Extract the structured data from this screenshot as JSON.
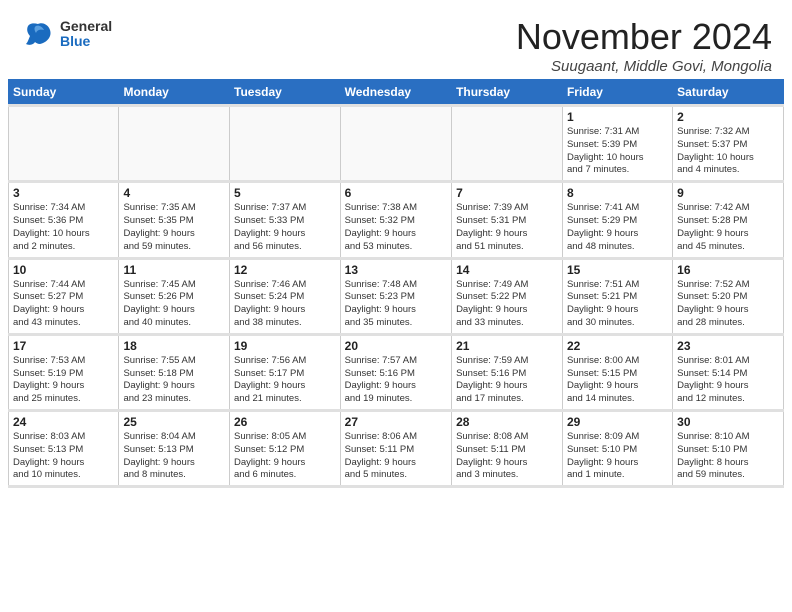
{
  "header": {
    "logo_text_general": "General",
    "logo_text_blue": "Blue",
    "month_title": "November 2024",
    "location": "Suugaant, Middle Govi, Mongolia"
  },
  "calendar": {
    "columns": [
      "Sunday",
      "Monday",
      "Tuesday",
      "Wednesday",
      "Thursday",
      "Friday",
      "Saturday"
    ],
    "weeks": [
      [
        {
          "day": "",
          "info": ""
        },
        {
          "day": "",
          "info": ""
        },
        {
          "day": "",
          "info": ""
        },
        {
          "day": "",
          "info": ""
        },
        {
          "day": "",
          "info": ""
        },
        {
          "day": "1",
          "info": "Sunrise: 7:31 AM\nSunset: 5:39 PM\nDaylight: 10 hours\nand 7 minutes."
        },
        {
          "day": "2",
          "info": "Sunrise: 7:32 AM\nSunset: 5:37 PM\nDaylight: 10 hours\nand 4 minutes."
        }
      ],
      [
        {
          "day": "3",
          "info": "Sunrise: 7:34 AM\nSunset: 5:36 PM\nDaylight: 10 hours\nand 2 minutes."
        },
        {
          "day": "4",
          "info": "Sunrise: 7:35 AM\nSunset: 5:35 PM\nDaylight: 9 hours\nand 59 minutes."
        },
        {
          "day": "5",
          "info": "Sunrise: 7:37 AM\nSunset: 5:33 PM\nDaylight: 9 hours\nand 56 minutes."
        },
        {
          "day": "6",
          "info": "Sunrise: 7:38 AM\nSunset: 5:32 PM\nDaylight: 9 hours\nand 53 minutes."
        },
        {
          "day": "7",
          "info": "Sunrise: 7:39 AM\nSunset: 5:31 PM\nDaylight: 9 hours\nand 51 minutes."
        },
        {
          "day": "8",
          "info": "Sunrise: 7:41 AM\nSunset: 5:29 PM\nDaylight: 9 hours\nand 48 minutes."
        },
        {
          "day": "9",
          "info": "Sunrise: 7:42 AM\nSunset: 5:28 PM\nDaylight: 9 hours\nand 45 minutes."
        }
      ],
      [
        {
          "day": "10",
          "info": "Sunrise: 7:44 AM\nSunset: 5:27 PM\nDaylight: 9 hours\nand 43 minutes."
        },
        {
          "day": "11",
          "info": "Sunrise: 7:45 AM\nSunset: 5:26 PM\nDaylight: 9 hours\nand 40 minutes."
        },
        {
          "day": "12",
          "info": "Sunrise: 7:46 AM\nSunset: 5:24 PM\nDaylight: 9 hours\nand 38 minutes."
        },
        {
          "day": "13",
          "info": "Sunrise: 7:48 AM\nSunset: 5:23 PM\nDaylight: 9 hours\nand 35 minutes."
        },
        {
          "day": "14",
          "info": "Sunrise: 7:49 AM\nSunset: 5:22 PM\nDaylight: 9 hours\nand 33 minutes."
        },
        {
          "day": "15",
          "info": "Sunrise: 7:51 AM\nSunset: 5:21 PM\nDaylight: 9 hours\nand 30 minutes."
        },
        {
          "day": "16",
          "info": "Sunrise: 7:52 AM\nSunset: 5:20 PM\nDaylight: 9 hours\nand 28 minutes."
        }
      ],
      [
        {
          "day": "17",
          "info": "Sunrise: 7:53 AM\nSunset: 5:19 PM\nDaylight: 9 hours\nand 25 minutes."
        },
        {
          "day": "18",
          "info": "Sunrise: 7:55 AM\nSunset: 5:18 PM\nDaylight: 9 hours\nand 23 minutes."
        },
        {
          "day": "19",
          "info": "Sunrise: 7:56 AM\nSunset: 5:17 PM\nDaylight: 9 hours\nand 21 minutes."
        },
        {
          "day": "20",
          "info": "Sunrise: 7:57 AM\nSunset: 5:16 PM\nDaylight: 9 hours\nand 19 minutes."
        },
        {
          "day": "21",
          "info": "Sunrise: 7:59 AM\nSunset: 5:16 PM\nDaylight: 9 hours\nand 17 minutes."
        },
        {
          "day": "22",
          "info": "Sunrise: 8:00 AM\nSunset: 5:15 PM\nDaylight: 9 hours\nand 14 minutes."
        },
        {
          "day": "23",
          "info": "Sunrise: 8:01 AM\nSunset: 5:14 PM\nDaylight: 9 hours\nand 12 minutes."
        }
      ],
      [
        {
          "day": "24",
          "info": "Sunrise: 8:03 AM\nSunset: 5:13 PM\nDaylight: 9 hours\nand 10 minutes."
        },
        {
          "day": "25",
          "info": "Sunrise: 8:04 AM\nSunset: 5:13 PM\nDaylight: 9 hours\nand 8 minutes."
        },
        {
          "day": "26",
          "info": "Sunrise: 8:05 AM\nSunset: 5:12 PM\nDaylight: 9 hours\nand 6 minutes."
        },
        {
          "day": "27",
          "info": "Sunrise: 8:06 AM\nSunset: 5:11 PM\nDaylight: 9 hours\nand 5 minutes."
        },
        {
          "day": "28",
          "info": "Sunrise: 8:08 AM\nSunset: 5:11 PM\nDaylight: 9 hours\nand 3 minutes."
        },
        {
          "day": "29",
          "info": "Sunrise: 8:09 AM\nSunset: 5:10 PM\nDaylight: 9 hours\nand 1 minute."
        },
        {
          "day": "30",
          "info": "Sunrise: 8:10 AM\nSunset: 5:10 PM\nDaylight: 8 hours\nand 59 minutes."
        }
      ]
    ]
  }
}
